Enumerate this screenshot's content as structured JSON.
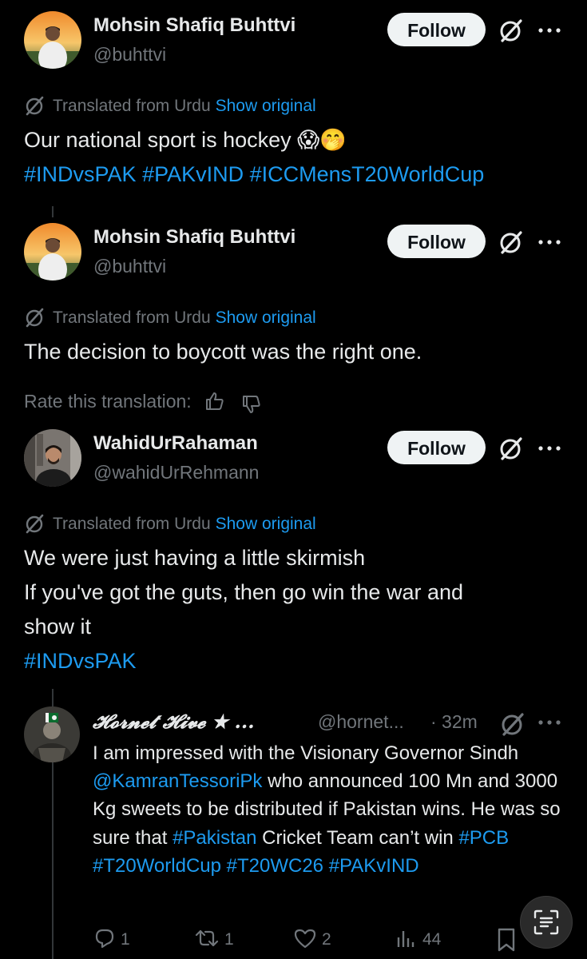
{
  "posts": [
    {
      "name": "Mohsin Shafiq Buhttvi",
      "handle": "@buhttvi",
      "follow_label": "Follow",
      "translated_label": "Translated from Urdu",
      "show_original_label": "Show original",
      "text_line": "Our national sport is hockey 😱🤭",
      "hashtags": [
        "#INDvsPAK",
        "#PAKvIND",
        "#ICCMensT20WorldCup"
      ]
    },
    {
      "name": "Mohsin Shafiq Buhttvi",
      "handle": "@buhttvi",
      "follow_label": "Follow",
      "translated_label": "Translated from Urdu",
      "show_original_label": "Show original",
      "text_line": "The decision to boycott was the right one.",
      "rate_label": "Rate this translation:"
    },
    {
      "name": "WahidUrRahaman",
      "handle": "@wahidUrRehmann",
      "follow_label": "Follow",
      "translated_label": "Translated from Urdu",
      "show_original_label": "Show original",
      "lines": [
        "We were just having a little skirmish",
        "If you've got the guts, then go win the war and",
        "show it"
      ],
      "hashtag": "#INDvsPAK"
    }
  ],
  "reply": {
    "name": "𝓗𝓸𝓻𝓷𝓮𝓽 𝓗𝓲𝓿𝓮 ★ ...",
    "handle": "@hornet...",
    "time": "· 32m",
    "body": {
      "t1": "I am impressed with the Visionary Governor Sindh ",
      "mention": "@KamranTessoriPk",
      "t2": " who announced 100 Mn and 3000 Kg sweets to be distributed if Pakistan wins. He was so sure that ",
      "tag1": "#Pakistan",
      "t3": " Cricket Team can’t win ",
      "tag2": "#PCB",
      "tag3": "#T20WorldCup",
      "tag4": "#T20WC26",
      "tag5": "#PAKvIND"
    },
    "actions": {
      "replies": "1",
      "reposts": "1",
      "likes": "2",
      "views": "44"
    }
  },
  "colors": {
    "accent": "#1d9bf0",
    "muted": "#71767b",
    "text": "#e7e9ea",
    "background": "#000000"
  },
  "icons": [
    "translate-icon",
    "grok-icon",
    "more-icon",
    "thumbs-up-icon",
    "thumbs-down-icon",
    "reply-icon",
    "repost-icon",
    "like-icon",
    "views-icon",
    "bookmark-icon",
    "text-scan-icon"
  ]
}
